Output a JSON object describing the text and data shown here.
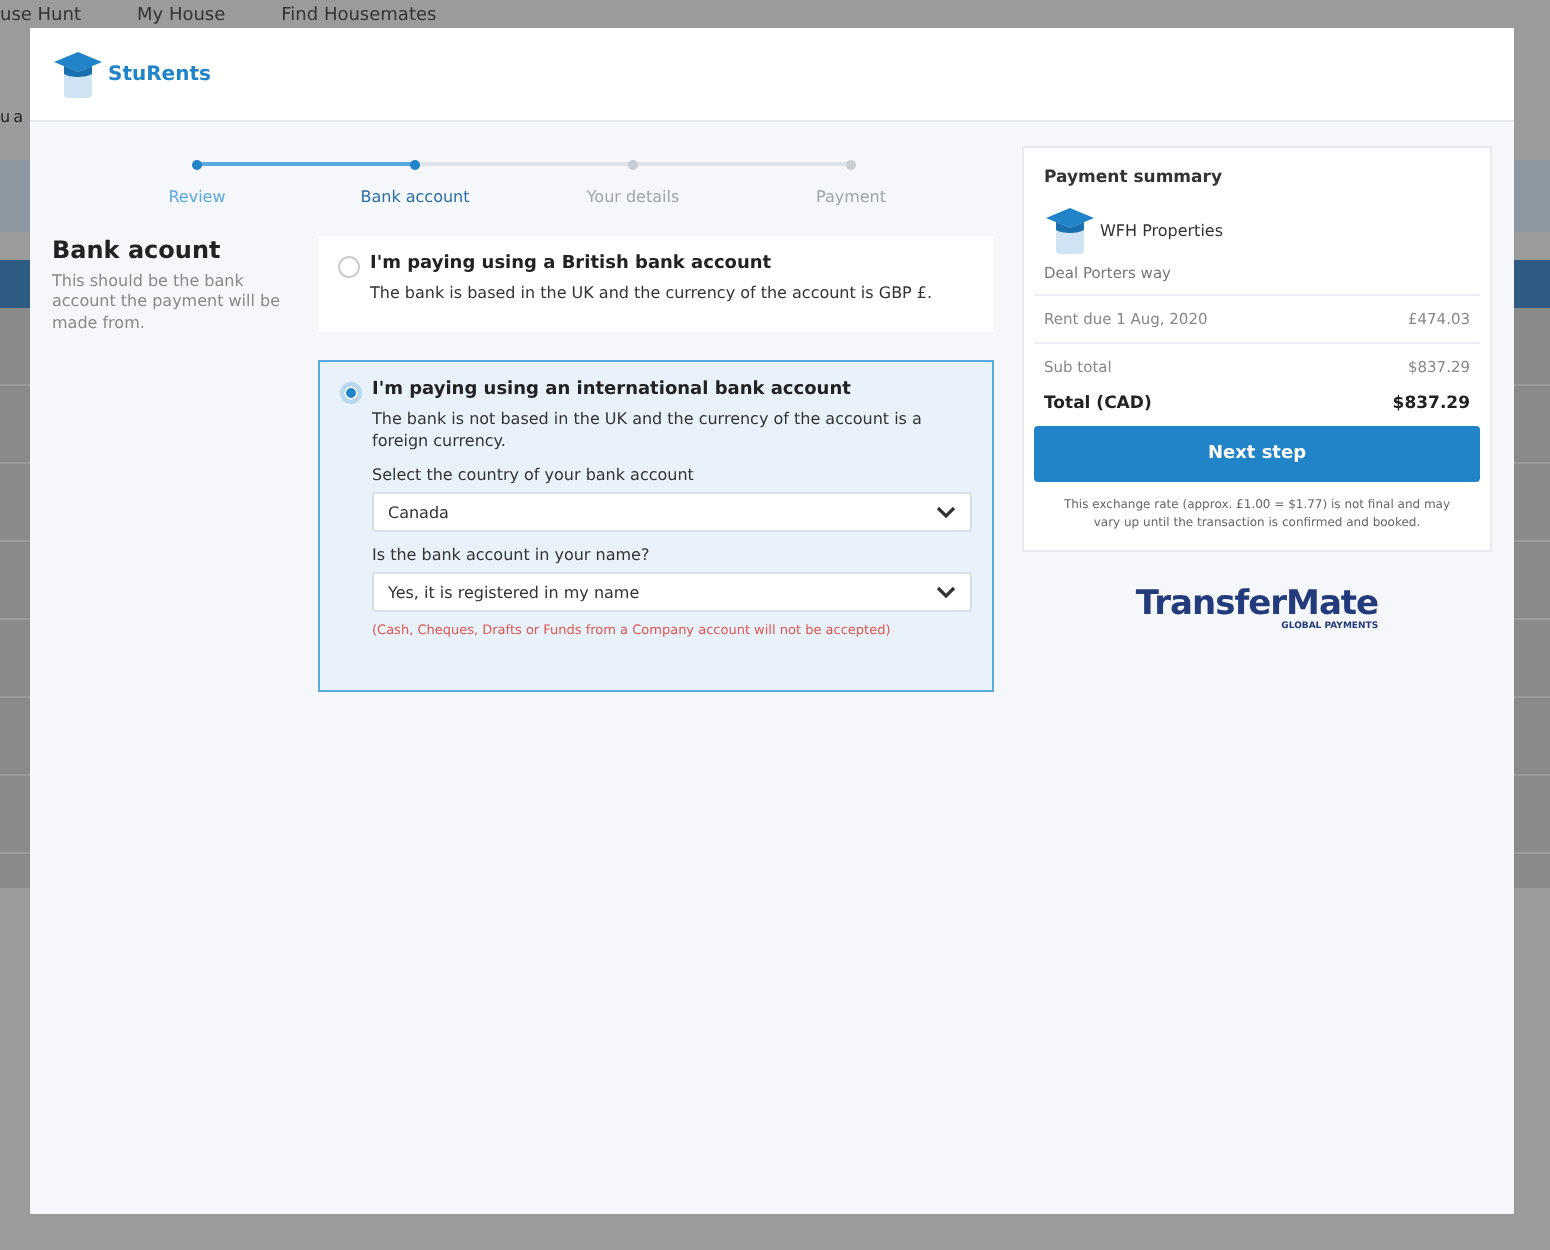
{
  "backdrop": {
    "nav": [
      "use Hunt",
      "My House",
      "Find Housemates"
    ],
    "notice": "u a"
  },
  "header": {
    "brand": "StuRents"
  },
  "steps": [
    {
      "label": "Review",
      "completed": true,
      "selected": false
    },
    {
      "label": "Bank account",
      "completed": true,
      "selected": true
    },
    {
      "label": "Your details",
      "completed": false,
      "selected": false
    },
    {
      "label": "Payment",
      "completed": false,
      "selected": false
    }
  ],
  "section": {
    "title": "Bank acount",
    "description": "This should be the bank account the payment will be made from."
  },
  "options": [
    {
      "title": "I'm paying using a British bank account",
      "description": "The bank is based in the UK and the currency of the account is GBP £.",
      "selected": false
    },
    {
      "title": "I'm paying using an international bank account",
      "description": "The bank is not based in the UK and the currency of the account is a foreign currency.",
      "selected": true,
      "fields": [
        {
          "label": "Select the country of your bank account",
          "value": "Canada"
        },
        {
          "label": "Is the bank account in your name?",
          "value": "Yes, it is registered in my name"
        }
      ],
      "warning": "(Cash, Cheques, Drafts or Funds from a Company account will not be accepted)"
    }
  ],
  "summary": {
    "title": "Payment summary",
    "landlord": "WFH Properties",
    "property": "Deal Porters way",
    "lines": [
      {
        "label": "Rent due 1 Aug, 2020",
        "amount": "£474.03"
      },
      {
        "label": "Sub total",
        "amount": "$837.29"
      }
    ],
    "total": {
      "label": "Total (CAD)",
      "amount": "$837.29"
    },
    "button": "Next step",
    "note": "This exchange rate (approx. £1.00 = $1.77) is not final and may vary up until the transaction is confirmed and booked."
  },
  "partner": {
    "name": "TransferMate",
    "tagline": "GLOBAL PAYMENTS"
  }
}
